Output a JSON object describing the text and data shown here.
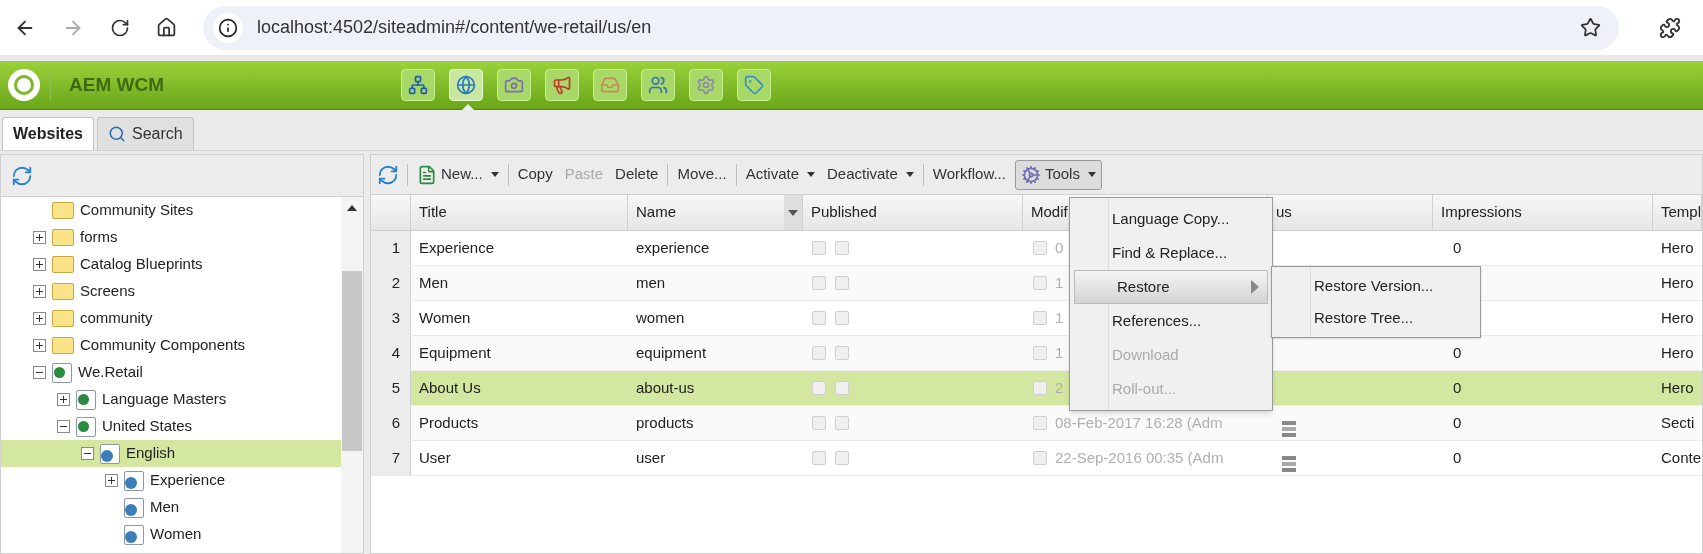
{
  "browser": {
    "url": "localhost:4502/siteadmin#/content/we-retail/us/en"
  },
  "app": {
    "title": "AEM WCM",
    "toolbar": [
      {
        "selected": false
      },
      {
        "selected": true
      },
      {
        "selected": false
      },
      {
        "selected": false
      },
      {
        "selected": false
      },
      {
        "selected": false
      },
      {
        "selected": false
      },
      {
        "selected": false
      }
    ]
  },
  "tabs": [
    {
      "label": "Websites",
      "selected": true
    },
    {
      "label": "Search",
      "selected": false
    }
  ],
  "tree": [
    {
      "label": "Community Sites",
      "kind": "folder",
      "selected": false
    },
    {
      "label": "forms",
      "kind": "folder",
      "expanded": false,
      "selected": false
    },
    {
      "label": "Catalog Blueprints",
      "kind": "folder",
      "expanded": false,
      "selected": false
    },
    {
      "label": "Screens",
      "kind": "folder",
      "expanded": false,
      "selected": false
    },
    {
      "label": "community",
      "kind": "folder",
      "expanded": false,
      "selected": false
    },
    {
      "label": "Community Components",
      "kind": "folder",
      "expanded": false,
      "selected": false
    },
    {
      "label": "We.Retail",
      "kind": "page",
      "expanded": true,
      "selected": false,
      "children": [
        {
          "label": "Language Masters",
          "kind": "page",
          "expanded": false,
          "selected": false
        },
        {
          "label": "United States",
          "kind": "page",
          "expanded": true,
          "selected": false,
          "children": [
            {
              "label": "English",
              "kind": "livecopy",
              "expanded": true,
              "selected": true,
              "children": [
                {
                  "label": "Experience",
                  "kind": "livecopy",
                  "expanded": false,
                  "selected": false
                },
                {
                  "label": "Men",
                  "kind": "livecopy",
                  "selected": false
                },
                {
                  "label": "Women",
                  "kind": "livecopy",
                  "selected": false
                }
              ]
            }
          ]
        }
      ]
    }
  ],
  "toolbar": [
    {
      "kind": "refresh"
    },
    {
      "kind": "separator"
    },
    {
      "kind": "new",
      "label": "New...",
      "dropdown": true,
      "disabled": false
    },
    {
      "kind": "separator"
    },
    {
      "kind": "button",
      "label": "Copy",
      "disabled": false
    },
    {
      "kind": "button",
      "label": "Paste",
      "disabled": true
    },
    {
      "kind": "button",
      "label": "Delete",
      "disabled": false
    },
    {
      "kind": "separator"
    },
    {
      "kind": "button",
      "label": "Move...",
      "disabled": false
    },
    {
      "kind": "separator"
    },
    {
      "kind": "button",
      "label": "Activate",
      "dropdown": true,
      "disabled": false
    },
    {
      "kind": "button",
      "label": "Deactivate",
      "dropdown": true,
      "disabled": false
    },
    {
      "kind": "separator"
    },
    {
      "kind": "button",
      "label": "Workflow...",
      "disabled": false
    },
    {
      "kind": "tools",
      "label": "Tools",
      "dropdown": true,
      "disabled": false,
      "pressed": true
    }
  ],
  "table": {
    "columns": [
      {
        "label": "Title"
      },
      {
        "label": "Name",
        "menu": true
      },
      {
        "label": "Published"
      },
      {
        "label": "Modif"
      },
      {
        "label": "us"
      },
      {
        "label": "Impressions"
      },
      {
        "label": "Templ"
      }
    ],
    "rows": [
      {
        "num": "1",
        "title": "Experience",
        "name": "experience",
        "modified": "0",
        "impressions": "0",
        "template": "Hero",
        "selected": false
      },
      {
        "num": "2",
        "title": "Men",
        "name": "men",
        "modified": "1",
        "template": "Hero",
        "selected": false
      },
      {
        "num": "3",
        "title": "Women",
        "name": "women",
        "modified": "1",
        "template": "Hero",
        "selected": false
      },
      {
        "num": "4",
        "title": "Equipment",
        "name": "equipment",
        "modified": "1",
        "impressions": "0",
        "template": "Hero",
        "selected": false
      },
      {
        "num": "5",
        "title": "About Us",
        "name": "about-us",
        "modified": "2",
        "impressions": "0",
        "template": "Hero",
        "selected": true
      },
      {
        "num": "6",
        "title": "Products",
        "name": "products",
        "modified": "08-Feb-2017 16:28 (Adm",
        "status_icon": true,
        "impressions": "0",
        "template": "Secti",
        "selected": false
      },
      {
        "num": "7",
        "title": "User",
        "name": "user",
        "modified": "22-Sep-2016 00:35 (Adm",
        "status_icon": true,
        "impressions": "0",
        "template": "Conte",
        "selected": false
      }
    ]
  },
  "menu": {
    "items": [
      {
        "label": "Language Copy...",
        "disabled": false,
        "highlighted": false
      },
      {
        "label": "Find & Replace...",
        "disabled": false,
        "highlighted": false
      },
      {
        "label": "Restore",
        "disabled": false,
        "highlighted": true,
        "submenu": [
          {
            "label": "Restore Version..."
          },
          {
            "label": "Restore Tree..."
          }
        ]
      },
      {
        "label": "References...",
        "disabled": false,
        "highlighted": false
      },
      {
        "label": "Download",
        "disabled": true,
        "highlighted": false
      },
      {
        "label": "Roll-out...",
        "disabled": true,
        "highlighted": false
      }
    ]
  }
}
